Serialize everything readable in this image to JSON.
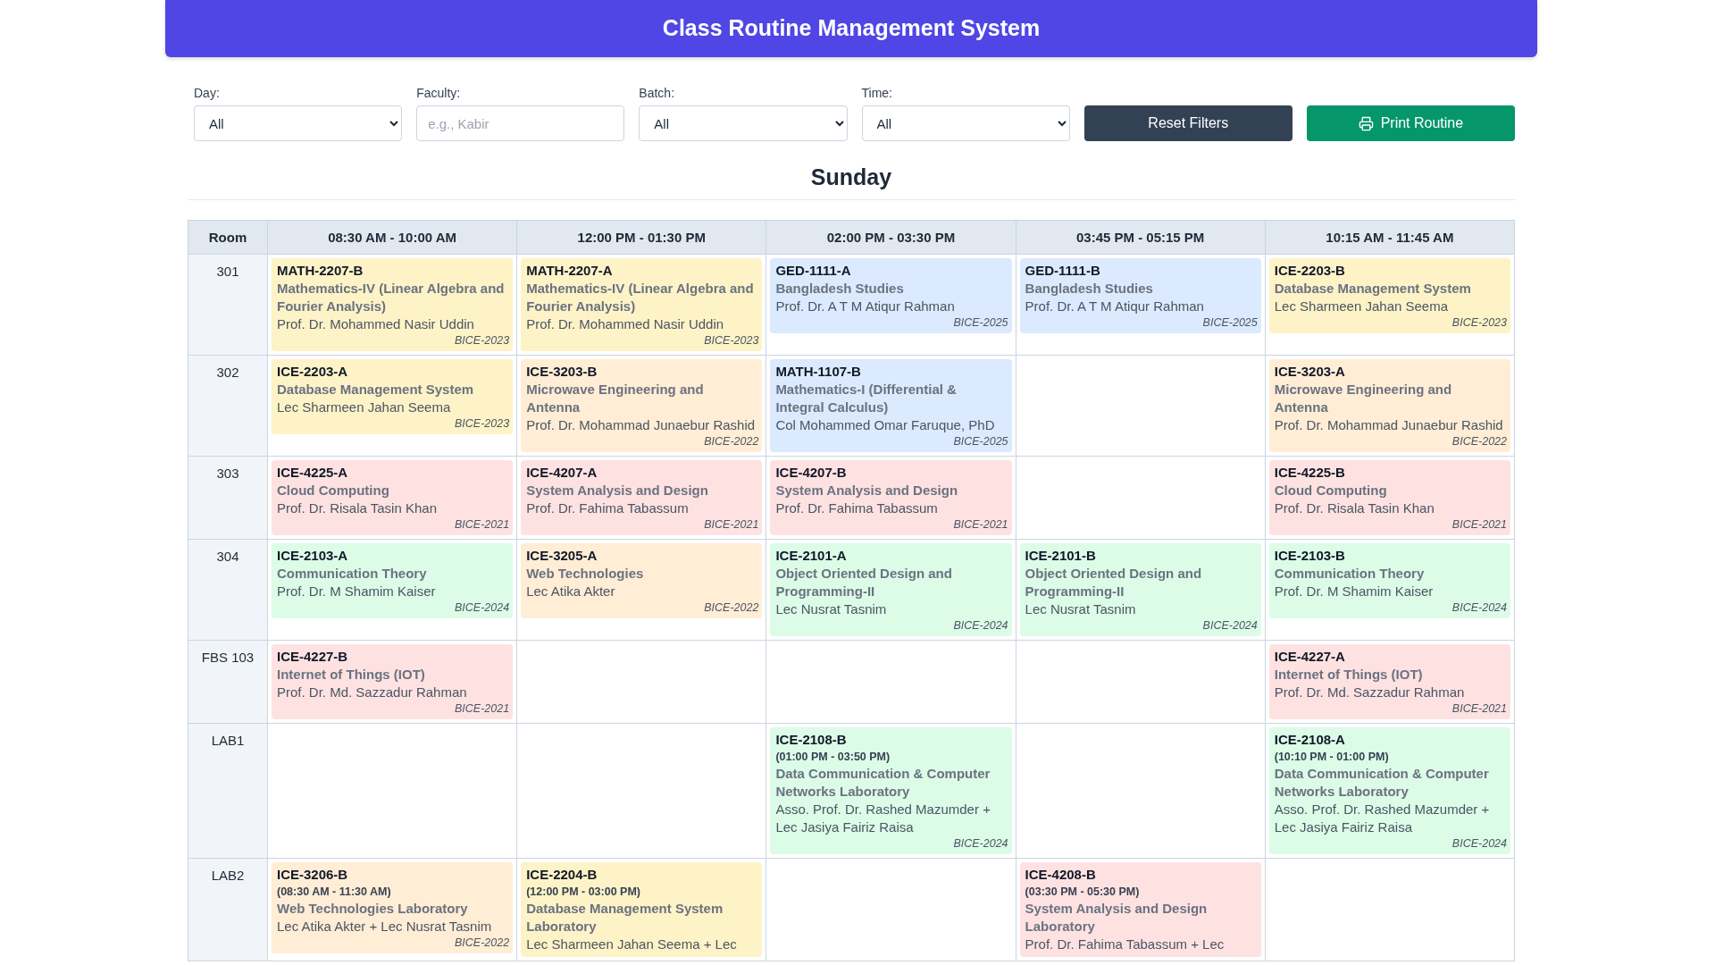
{
  "header": {
    "title": "Class Routine Management System"
  },
  "filters": [
    {
      "kind": "select",
      "label": "Day:",
      "value": "All"
    },
    {
      "kind": "text",
      "label": "Faculty:",
      "placeholder": "e.g., Kabir"
    },
    {
      "kind": "select",
      "label": "Batch:",
      "value": "All"
    },
    {
      "kind": "select",
      "label": "Time:",
      "value": "All"
    }
  ],
  "buttons": [
    {
      "kind": "reset",
      "label": "Reset Filters"
    },
    {
      "kind": "print",
      "label": "Print Routine"
    }
  ],
  "day": "Sunday",
  "table": {
    "columns": [
      "Room",
      "08:30 AM - 10:00 AM",
      "12:00 PM - 01:30 PM",
      "02:00 PM - 03:30 PM",
      "03:45 PM - 05:15 PM",
      "10:15 AM - 11:45 AM"
    ],
    "rows": [
      {
        "cells": [
          {
            "kind": "room",
            "text": "301"
          },
          {
            "kind": "class",
            "code": "MATH-2207-B",
            "title": "Mathematics-IV (Linear Algebra and Fourier Analysis)",
            "faculty": "Prof. Dr. Mohammed Nasir Uddin",
            "batch": "BICE-2023",
            "color": "#fef3c7"
          },
          {
            "kind": "class",
            "code": "MATH-2207-A",
            "title": "Mathematics-IV (Linear Algebra and Fourier Analysis)",
            "faculty": "Prof. Dr. Mohammed Nasir Uddin",
            "batch": "BICE-2023",
            "color": "#fef3c7"
          },
          {
            "kind": "class",
            "code": "GED-1111-A",
            "title": "Bangladesh Studies",
            "faculty": "Prof. Dr. A T M Atiqur Rahman",
            "batch": "BICE-2025",
            "color": "#dbeafe"
          },
          {
            "kind": "class",
            "code": "GED-1111-B",
            "title": "Bangladesh Studies",
            "faculty": "Prof. Dr. A T M Atiqur Rahman",
            "batch": "BICE-2025",
            "color": "#dbeafe"
          },
          {
            "kind": "class",
            "code": "ICE-2203-B",
            "title": "Database Management System",
            "faculty": "Lec Sharmeen Jahan Seema",
            "batch": "BICE-2023",
            "color": "#fef3c7"
          }
        ]
      },
      {
        "cells": [
          {
            "kind": "room",
            "text": "302"
          },
          {
            "kind": "class",
            "code": "ICE-2203-A",
            "title": "Database Management System",
            "faculty": "Lec Sharmeen Jahan Seema",
            "batch": "BICE-2023",
            "color": "#fef3c7"
          },
          {
            "kind": "class",
            "code": "ICE-3203-B",
            "title": "Microwave Engineering and Antenna",
            "faculty": "Prof. Dr. Mohammad Junaebur Rashid",
            "batch": "BICE-2022",
            "color": "#ffedd5"
          },
          {
            "kind": "class",
            "code": "MATH-1107-B",
            "title": "Mathematics-I (Differential & Integral Calculus)",
            "faculty": "Col Mohammed Omar Faruque, PhD",
            "batch": "BICE-2025",
            "color": "#dbeafe"
          },
          null,
          {
            "kind": "class",
            "code": "ICE-3203-A",
            "title": "Microwave Engineering and Antenna",
            "faculty": "Prof. Dr. Mohammad Junaebur Rashid",
            "batch": "BICE-2022",
            "color": "#ffedd5"
          }
        ]
      },
      {
        "cells": [
          {
            "kind": "room",
            "text": "303"
          },
          {
            "kind": "class",
            "code": "ICE-4225-A",
            "title": "Cloud Computing",
            "faculty": "Prof. Dr. Risala Tasin Khan",
            "batch": "BICE-2021",
            "color": "#fee2e2"
          },
          {
            "kind": "class",
            "code": "ICE-4207-A",
            "title": "System Analysis and Design",
            "faculty": "Prof. Dr. Fahima Tabassum",
            "batch": "BICE-2021",
            "color": "#fee2e2"
          },
          {
            "kind": "class",
            "code": "ICE-4207-B",
            "title": "System Analysis and Design",
            "faculty": "Prof. Dr. Fahima Tabassum",
            "batch": "BICE-2021",
            "color": "#fee2e2"
          },
          null,
          {
            "kind": "class",
            "code": "ICE-4225-B",
            "title": "Cloud Computing",
            "faculty": "Prof. Dr. Risala Tasin Khan",
            "batch": "BICE-2021",
            "color": "#fee2e2"
          }
        ]
      },
      {
        "cells": [
          {
            "kind": "room",
            "text": "304"
          },
          {
            "kind": "class",
            "code": "ICE-2103-A",
            "title": "Communication Theory",
            "faculty": "Prof. Dr. M Shamim Kaiser",
            "batch": "BICE-2024",
            "color": "#dcfce7"
          },
          {
            "kind": "class",
            "code": "ICE-3205-A",
            "title": "Web Technologies",
            "faculty": "Lec Atika Akter",
            "batch": "BICE-2022",
            "color": "#ffedd5"
          },
          {
            "kind": "class",
            "code": "ICE-2101-A",
            "title": "Object Oriented Design and Programming-II",
            "faculty": "Lec Nusrat Tasnim",
            "batch": "BICE-2024",
            "color": "#dcfce7"
          },
          {
            "kind": "class",
            "code": "ICE-2101-B",
            "title": "Object Oriented Design and Programming-II",
            "faculty": "Lec Nusrat Tasnim",
            "batch": "BICE-2024",
            "color": "#dcfce7"
          },
          {
            "kind": "class",
            "code": "ICE-2103-B",
            "title": "Communication Theory",
            "faculty": "Prof. Dr. M Shamim Kaiser",
            "batch": "BICE-2024",
            "color": "#dcfce7"
          }
        ]
      },
      {
        "cells": [
          {
            "kind": "room",
            "text": "FBS 103"
          },
          {
            "kind": "class",
            "code": "ICE-4227-B",
            "title": "Internet of Things (IOT)",
            "faculty": "Prof. Dr. Md. Sazzadur Rahman",
            "batch": "BICE-2021",
            "color": "#fee2e2"
          },
          null,
          null,
          null,
          {
            "kind": "class",
            "code": "ICE-4227-A",
            "title": "Internet of Things (IOT)",
            "faculty": "Prof. Dr. Md. Sazzadur Rahman",
            "batch": "BICE-2021",
            "color": "#fee2e2"
          }
        ]
      },
      {
        "cells": [
          {
            "kind": "room",
            "text": "LAB1"
          },
          null,
          null,
          {
            "kind": "class",
            "code": "ICE-2108-B",
            "time": "(01:00 PM - 03:50 PM)",
            "title": "Data Communication & Computer Networks Laboratory",
            "faculty": "Asso. Prof. Dr. Rashed Mazumder + Lec Jasiya Fairiz Raisa",
            "batch": "BICE-2024",
            "color": "#dcfce7"
          },
          null,
          {
            "kind": "class",
            "code": "ICE-2108-A",
            "time": "(10:10 PM - 01:00 PM)",
            "title": "Data Communication & Computer Networks Laboratory",
            "faculty": "Asso. Prof. Dr. Rashed Mazumder + Lec Jasiya Fairiz Raisa",
            "batch": "BICE-2024",
            "color": "#dcfce7"
          }
        ]
      },
      {
        "cells": [
          {
            "kind": "room",
            "text": "LAB2"
          },
          {
            "kind": "class",
            "code": "ICE-3206-B",
            "time": "(08:30 AM - 11:30 AM)",
            "title": "Web Technologies Laboratory",
            "faculty": "Lec Atika Akter + Lec Nusrat Tasnim",
            "batch": "BICE-2022",
            "color": "#ffedd5"
          },
          {
            "kind": "class",
            "code": "ICE-2204-B",
            "time": "(12:00 PM - 03:00 PM)",
            "title": "Database Management System Laboratory",
            "faculty": "Lec Sharmeen Jahan Seema + Lec",
            "color": "#fef3c7"
          },
          null,
          {
            "kind": "class",
            "code": "ICE-4208-B",
            "time": "(03:30 PM - 05:30 PM)",
            "title": "System Analysis and Design Laboratory",
            "faculty": "Prof. Dr. Fahima Tabassum + Lec",
            "color": "#fee2e2"
          },
          null
        ]
      }
    ]
  }
}
